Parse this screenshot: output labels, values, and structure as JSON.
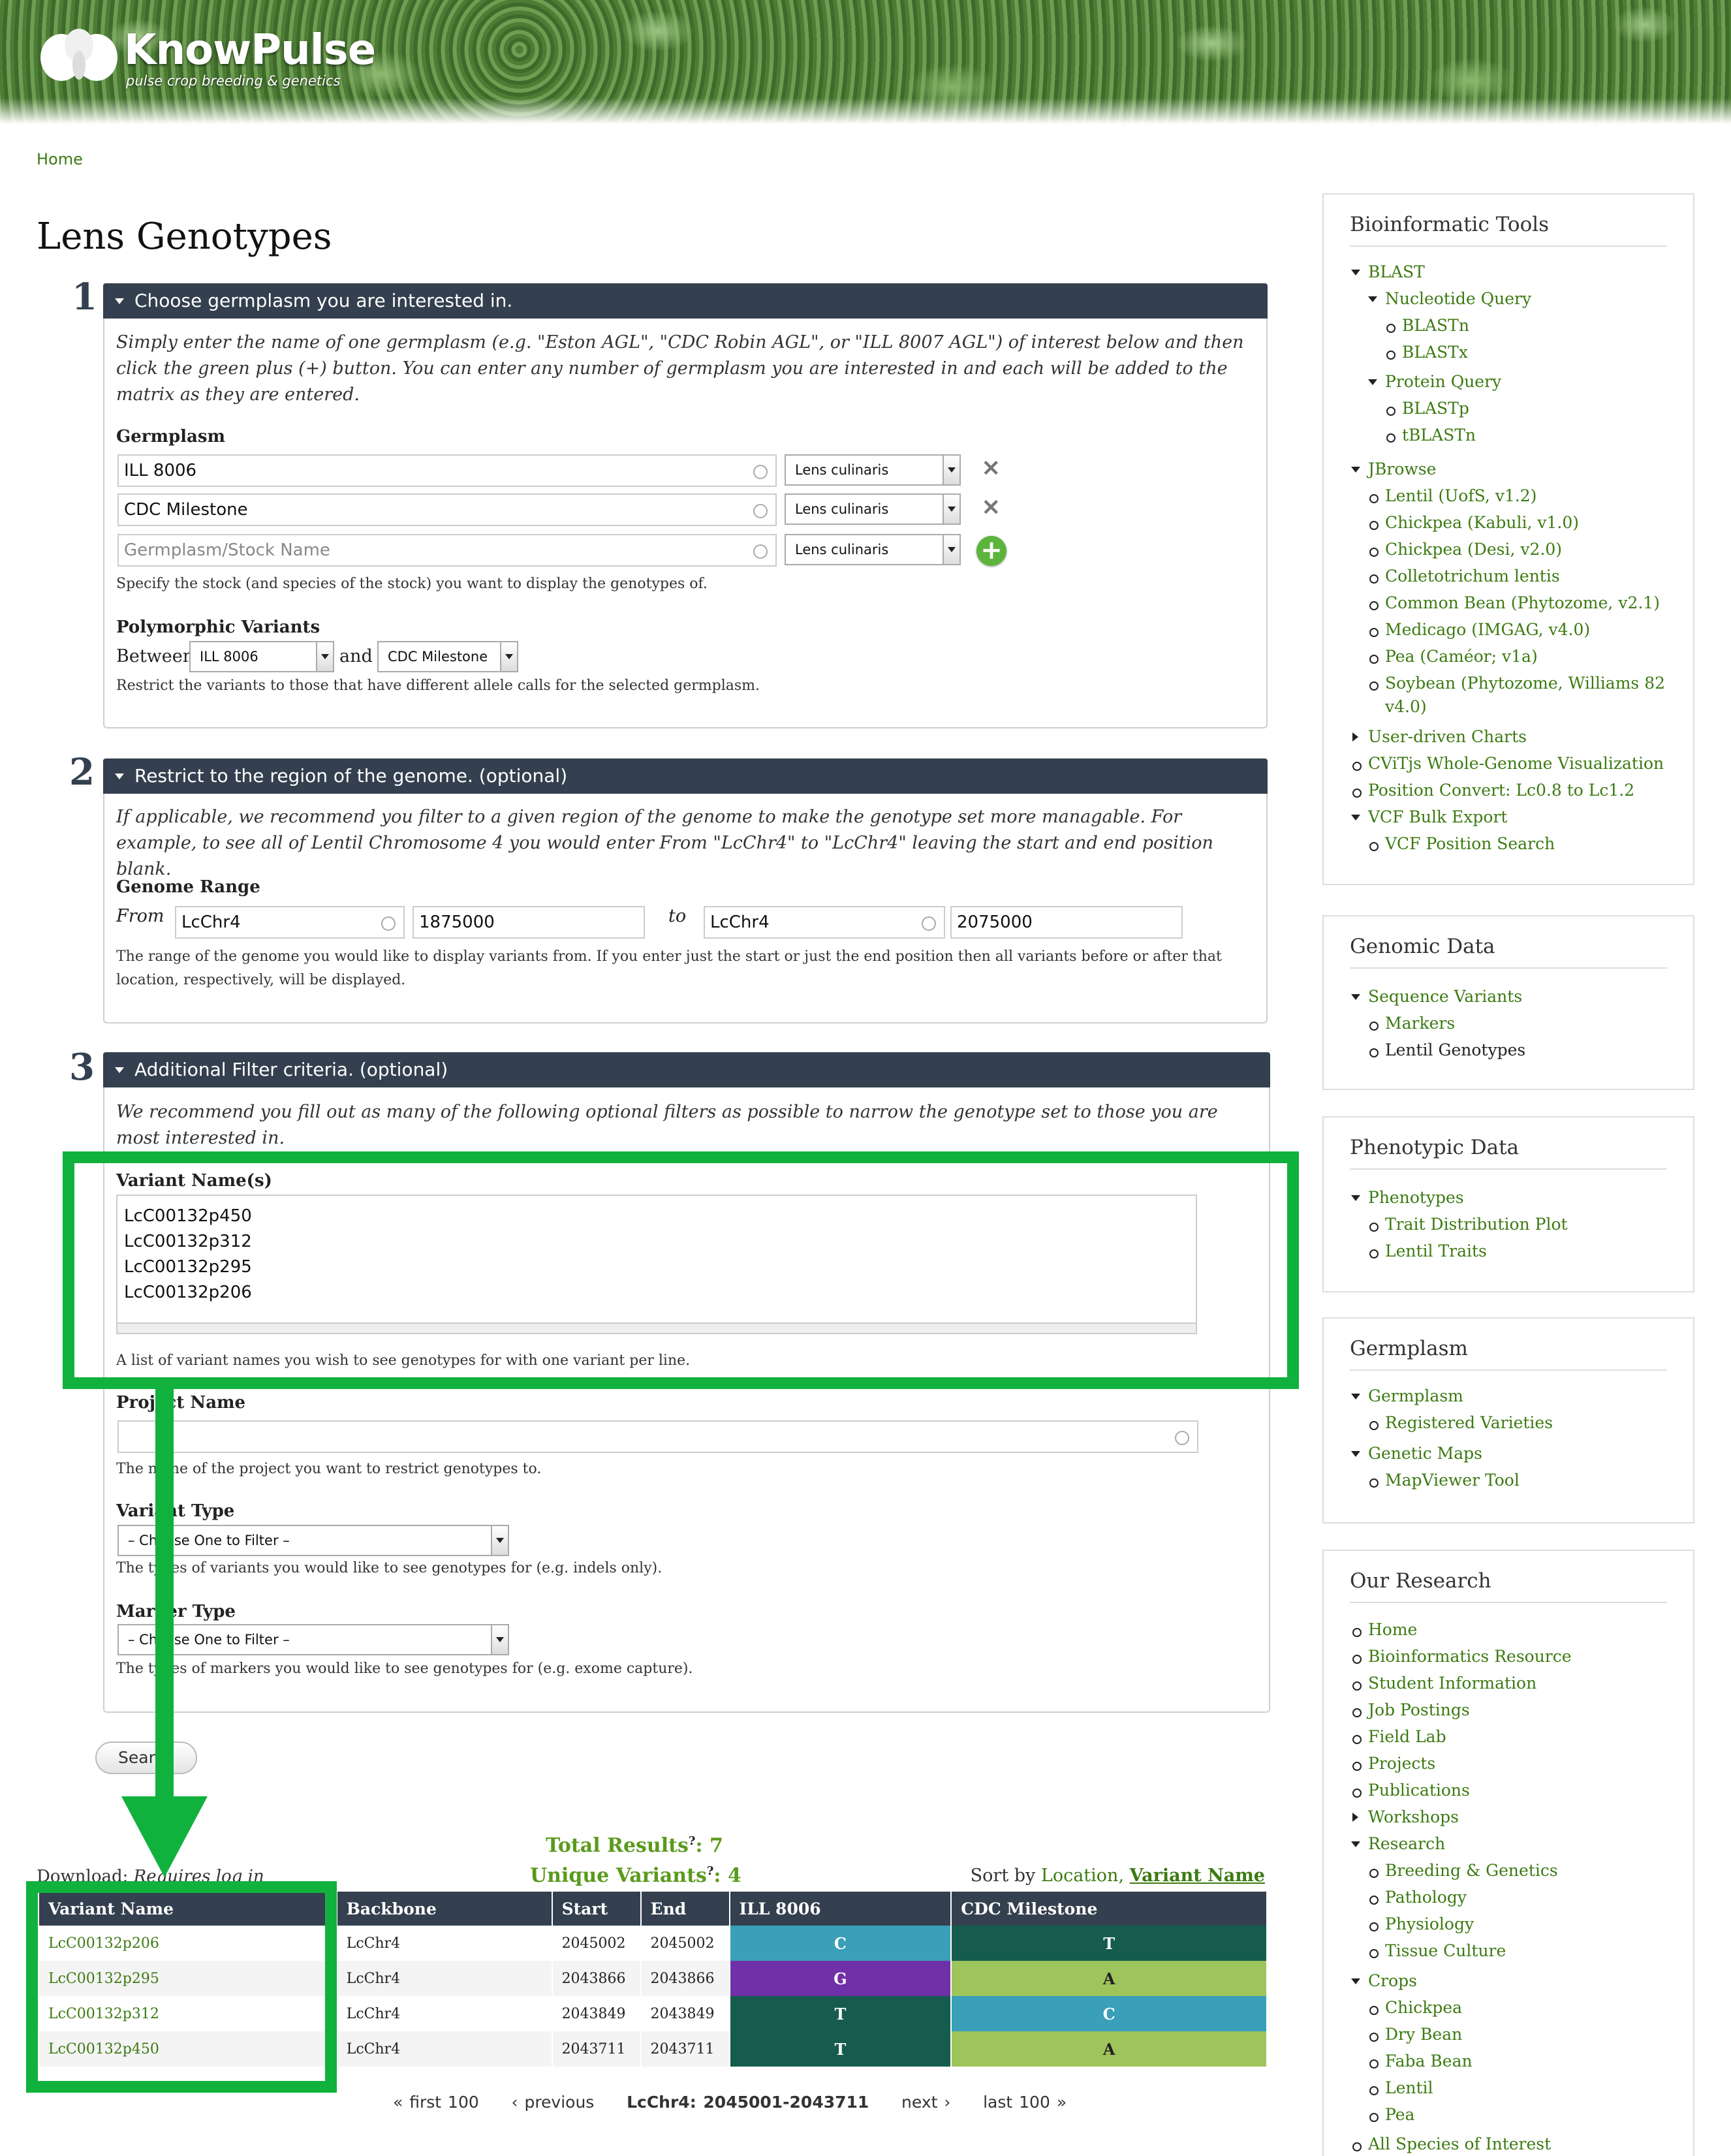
{
  "header": {
    "logo_title": "KnowPulse",
    "logo_subtitle": "pulse crop breeding & genetics"
  },
  "breadcrumb": "Home",
  "page_title": "Lens Genotypes",
  "step1": {
    "num": "1",
    "title": "Choose germplasm you are interested in.",
    "help": "Simply enter the name of one germplasm (e.g. \"Eston AGL\", \"CDC Robin AGL\", or \"ILL 8007 AGL\") of interest below and then click the green plus (+) button. You can enter any number of germplasm you are interested in and each will be added to the matrix as they are entered.",
    "germplasm_label": "Germplasm",
    "rows": [
      {
        "value": "ILL 8006",
        "species": "Lens culinaris"
      },
      {
        "value": "CDC Milestone",
        "species": "Lens culinaris"
      }
    ],
    "new_placeholder": "Germplasm/Stock Name",
    "new_species": "Lens culinaris",
    "germplasm_desc": "Specify the stock (and species of the stock) you want to display the genotypes of.",
    "poly_label": "Polymorphic Variants",
    "between": "Between",
    "and": "and",
    "poly_a": "ILL 8006",
    "poly_b": "CDC Milestone",
    "poly_desc": "Restrict the variants to those that have different allele calls for the selected germplasm."
  },
  "step2": {
    "num": "2",
    "title": "Restrict to the region of the genome. (optional)",
    "help": "If applicable, we recommend you filter to a given region of the genome to make the genotype set more managable. For example, to see all of Lentil Chromosome 4 you would enter From \"LcChr4\" to \"LcChr4\" leaving the start and end position blank.",
    "range_label": "Genome Range",
    "from": "From",
    "to": "to",
    "from_backbone": "LcChr4",
    "from_pos": "1875000",
    "to_backbone": "LcChr4",
    "to_pos": "2075000",
    "desc": "The range of the genome you would like to display variants from. If you enter just the start or just the end position then all variants before or after that location, respectively, will be displayed."
  },
  "step3": {
    "num": "3",
    "title": "Additional Filter criteria. (optional)",
    "help": "We recommend you fill out as many of the following optional filters as possible to narrow the genotype set to those you are most interested in.",
    "variant_label": "Variant Name(s)",
    "variant_lines": [
      "LcC00132p450",
      "LcC00132p312",
      "LcC00132p295",
      "LcC00132p206"
    ],
    "variant_desc": "A list of variant names you wish to see genotypes for with one variant per line.",
    "project_label": "Project Name",
    "project_desc": "The name of the project you want to restrict genotypes to.",
    "vtype_label": "Variant Type",
    "vtype_value": "– Choose One to Filter –",
    "vtype_desc": "The types of variants you would like to see genotypes for (e.g. indels only).",
    "mtype_label": "Marker Type",
    "mtype_value": "– Choose One to Filter –",
    "mtype_desc": "The types of markers you would like to see genotypes for (e.g. exome capture)."
  },
  "search_button": "Search",
  "results": {
    "total_label": "Total Results",
    "total": "7",
    "unique_label": "Unique Variants",
    "unique": "4",
    "help_mark": "?",
    "download": "Download:",
    "download_note": "Requires log in",
    "sort_by": "Sort by",
    "sort_location": "Location,",
    "sort_variant": "Variant Name",
    "columns": [
      "Variant Name",
      "Backbone",
      "Start",
      "End",
      "ILL 8006",
      "CDC Milestone"
    ],
    "rows": [
      [
        "LcC00132p206",
        "LcChr4",
        "2045002",
        "2045002",
        "C",
        "T"
      ],
      [
        "LcC00132p295",
        "LcChr4",
        "2043866",
        "2043866",
        "G",
        "A"
      ],
      [
        "LcC00132p312",
        "LcChr4",
        "2043849",
        "2043849",
        "T",
        "C"
      ],
      [
        "LcC00132p450",
        "LcChr4",
        "2043711",
        "2043711",
        "T",
        "A"
      ]
    ],
    "pager": {
      "first": "« first 100",
      "previous": "‹ previous",
      "current": "LcChr4: 2045001-2043711",
      "next": "next ›",
      "last": "last 100 »"
    }
  },
  "colors": {
    "header_bar": "#34404f",
    "link": "#3c7a12",
    "highlight": "#10b23d",
    "C": "#3a9fb8",
    "T": "#155c4e",
    "G": "#7030a8",
    "A": "#9ec45c"
  },
  "sidebar": {
    "tools": {
      "title": "Bioinformatic Tools",
      "items": [
        "BLAST",
        "Nucleotide Query",
        "BLASTn",
        "BLASTx",
        "Protein Query",
        "BLASTp",
        "tBLASTn",
        "JBrowse",
        "Lentil (UofS, v1.2)",
        "Chickpea (Kabuli, v1.0)",
        "Chickpea (Desi, v2.0)",
        "Colletotrichum lentis",
        "Common Bean (Phytozome, v2.1)",
        "Medicago (IMGAG, v4.0)",
        "Pea (Caméor; v1a)",
        "Soybean (Phytozome, Williams 82",
        "v4.0)",
        "User-driven Charts",
        "CViTjs Whole-Genome Visualization",
        "Position Convert: Lc0.8 to Lc1.2",
        "VCF Bulk Export",
        "VCF Position Search"
      ]
    },
    "genomic": {
      "title": "Genomic Data",
      "items": [
        "Sequence Variants",
        "Markers",
        "Lentil Genotypes"
      ]
    },
    "phenotypic": {
      "title": "Phenotypic Data",
      "items": [
        "Phenotypes",
        "Trait Distribution Plot",
        "Lentil Traits"
      ]
    },
    "germplasm": {
      "title": "Germplasm",
      "items": [
        "Germplasm",
        "Registered Varieties",
        "Genetic Maps",
        "MapViewer Tool"
      ]
    },
    "research": {
      "title": "Our Research",
      "items": [
        "Home",
        "Bioinformatics Resource",
        "Student Information",
        "Job Postings",
        "Field Lab",
        "Projects",
        "Publications",
        "Workshops",
        "Research",
        "Breeding & Genetics",
        "Pathology",
        "Physiology",
        "Tissue Culture",
        "Crops",
        "Chickpea",
        "Dry Bean",
        "Faba Bean",
        "Lentil",
        "Pea",
        "All Species of Interest"
      ]
    }
  }
}
